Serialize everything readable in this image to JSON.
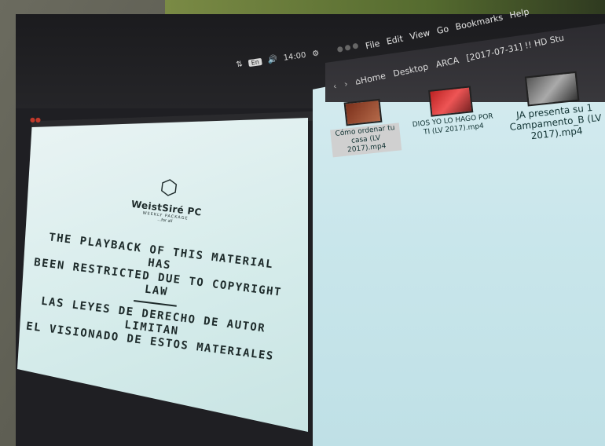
{
  "tray": {
    "lang": "En",
    "volume_icon": "volume-icon",
    "time": "14:00",
    "settings_icon": "gear-icon"
  },
  "slide": {
    "brand": "WeistSiré PC",
    "tagline": "WEEKLY PACKAGE",
    "tagline2": "...for all",
    "message_en_line1": "THE PLAYBACK OF THIS MATERIAL HAS",
    "message_en_line2": "BEEN RESTRICTED DUE TO COPYRIGHT LAW",
    "message_es_line1": "LAS LEYES DE DERECHO DE AUTOR LIMITAN",
    "message_es_line2": "EL VISIONADO DE ESTOS MATERIALES"
  },
  "menubar": {
    "items": [
      "File",
      "Edit",
      "View",
      "Go",
      "Bookmarks",
      "Help"
    ]
  },
  "pathbar": {
    "home": "Home",
    "crumbs": [
      "Desktop",
      "ARCA",
      "[2017-07-31] !! HD Stu"
    ]
  },
  "files": [
    {
      "name": "Cómo ordenar tu casa (LV 2017).mp4"
    },
    {
      "name": "DIOS YO LO HAGO POR TI (LV 2017).mp4"
    },
    {
      "name": "JA presenta su 1 Campamento_B (LV 2017).mp4"
    }
  ],
  "colors": {
    "slide_bg": "#d4ebea",
    "fm_bg": "#c9e6eb",
    "topbar": "#1b1b1e"
  }
}
